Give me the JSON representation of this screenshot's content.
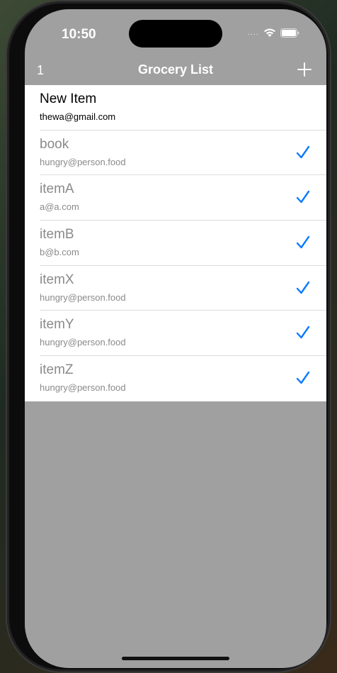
{
  "status_bar": {
    "time": "10:50",
    "signal": "....",
    "icons": [
      "wifi-icon",
      "battery-icon"
    ]
  },
  "navbar": {
    "count": "1",
    "title": "Grocery List",
    "add_icon": "plus-icon"
  },
  "items": [
    {
      "name": "New Item",
      "email": "thewa@gmail.com",
      "completed": false
    },
    {
      "name": "book",
      "email": "hungry@person.food",
      "completed": true
    },
    {
      "name": "itemA",
      "email": "a@a.com",
      "completed": true
    },
    {
      "name": "itemB",
      "email": "b@b.com",
      "completed": true
    },
    {
      "name": "itemX",
      "email": "hungry@person.food",
      "completed": true
    },
    {
      "name": "itemY",
      "email": "hungry@person.food",
      "completed": true
    },
    {
      "name": "itemZ",
      "email": "hungry@person.food",
      "completed": true
    }
  ],
  "colors": {
    "background": "#a0a0a0",
    "accent": "#0a7aff",
    "completed_text": "#8a8a8a"
  }
}
